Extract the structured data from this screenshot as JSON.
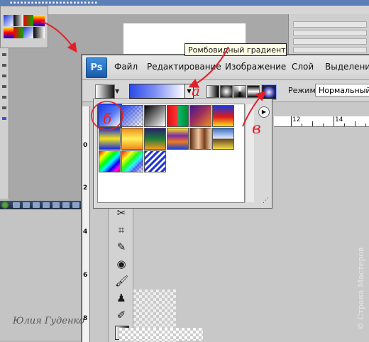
{
  "window": {
    "app_icon": "Ps",
    "menus": [
      "Файл",
      "Редактирование",
      "Изображение",
      "Слой",
      "Выделение"
    ]
  },
  "options_bar": {
    "mode_label": "Режим:",
    "mode_value": "Нормальный",
    "gradient_types": [
      "linear",
      "radial",
      "angle",
      "reflected",
      "diamond"
    ],
    "selected_gradient_type": "diamond"
  },
  "tooltip": "Ромбовидный градиент",
  "ruler": {
    "top_numbers": [
      "12",
      "14"
    ],
    "left_numbers": [
      "0",
      "2",
      "4",
      "6",
      "8"
    ]
  },
  "gradient_presets": [
    "foreground-to-background",
    "foreground-to-transparent",
    "black-white",
    "red-green",
    "violet-orange",
    "blue-red-yellow",
    "blue-yellow-blue",
    "orange-yellow-orange",
    "violet-green-orange",
    "yellow-violet-orange-blue",
    "copper",
    "chrome",
    "spectrum",
    "transparent-rainbow",
    "transparent-stripes"
  ],
  "annotations": {
    "a_label": "а",
    "b_label": "б",
    "v_label": "в"
  },
  "watermarks": {
    "author": "Юлия Гуденко",
    "site": "© Страна Мастеров"
  },
  "colors": {
    "photoshop_blue": "#1a5aa8",
    "annotation_red": "#e3202a",
    "tooltip_bg": "#ffffe6"
  },
  "icons": [
    "photoshop-logo-icon",
    "gradient-tool-icon",
    "eyedropper-icon",
    "brush-icon",
    "crop-icon",
    "stamp-icon",
    "eraser-icon",
    "lasso-icon",
    "panel-menu-icon"
  ]
}
